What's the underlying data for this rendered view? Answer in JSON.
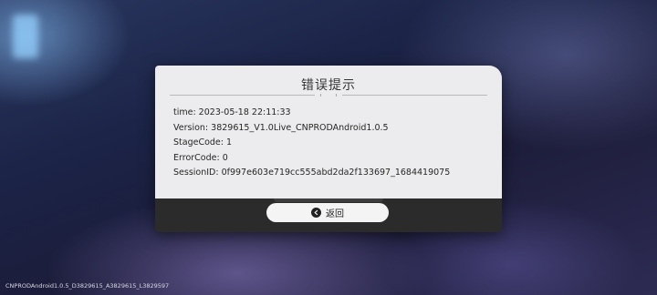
{
  "dialog": {
    "title": "错误提示",
    "info": [
      "time: 2023-05-18 22:11:33",
      "Version: 3829615_V1.0Live_CNPRODAndroid1.0.5",
      "StageCode: 1",
      "ErrorCode: 0",
      "SessionID: 0f997e603e719cc555abd2da2f133697_1684419075"
    ],
    "back_button": {
      "label": "返回",
      "icon": "back-arrow-icon"
    }
  },
  "footer": {
    "version_text": "CNPRODAndroid1.0.5_D3829615_A3829615_L3829597"
  },
  "colors": {
    "dialog_body": "#ececee",
    "dialog_footer": "#2b2b2b",
    "button_bg": "#f4f4f4"
  }
}
